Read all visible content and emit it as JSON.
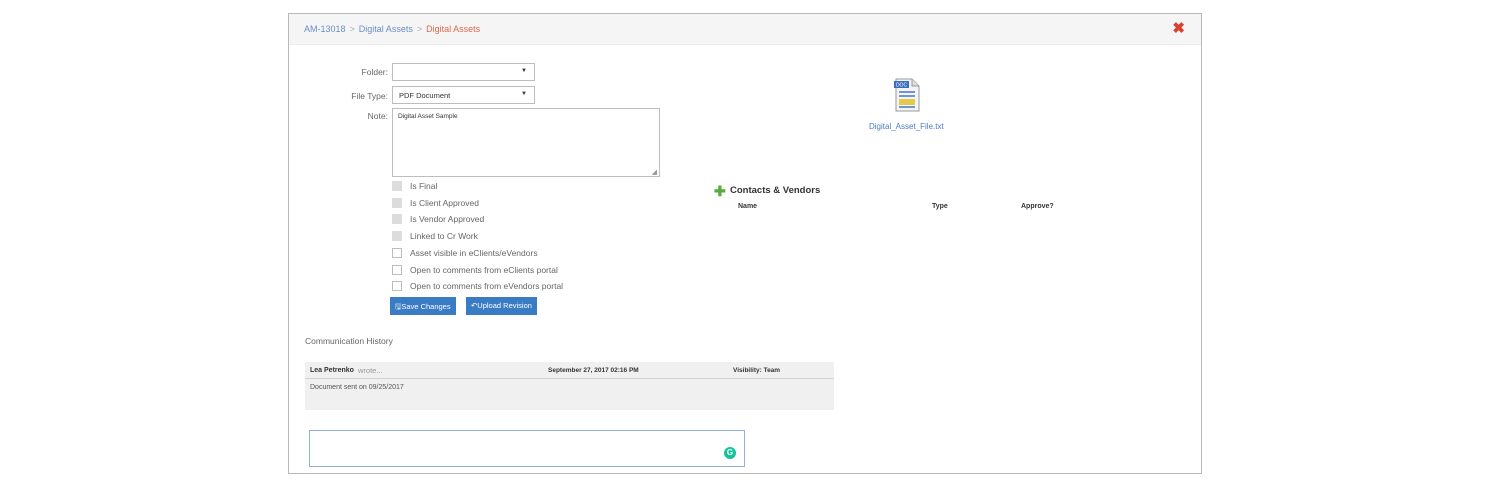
{
  "breadcrumb": {
    "id": "AM-13018",
    "parent": "Digital Assets",
    "current": "Digital Assets",
    "separator": ">"
  },
  "close_icon": "✖",
  "form": {
    "folder_label": "Folder:",
    "folder_value": "",
    "filetype_label": "File Type:",
    "filetype_value": "PDF Document",
    "note_label": "Note:",
    "note_value": "Digital Asset Sample"
  },
  "checkboxes": [
    {
      "label": "Is Final",
      "disabled": true
    },
    {
      "label": "Is Client Approved",
      "disabled": true
    },
    {
      "label": "Is Vendor Approved",
      "disabled": true
    },
    {
      "label": "Linked to Cr Work",
      "disabled": true
    },
    {
      "label": "Asset visible in eClients/eVendors",
      "disabled": false
    },
    {
      "label": "Open to comments from eClients portal",
      "disabled": false
    },
    {
      "label": "Open to comments from eVendors portal",
      "disabled": false
    }
  ],
  "buttons": {
    "save": "Save Changes",
    "upload": "Upload Revision"
  },
  "contacts": {
    "title": "Contacts & Vendors",
    "col_name": "Name",
    "col_type": "Type",
    "col_approve": "Approve?"
  },
  "file": {
    "name": "Digital_Asset_File.txt",
    "icon_label": "DOC",
    "icon": "doc-file-icon"
  },
  "communication": {
    "title": "Communication History",
    "author": "Lea Petrenko",
    "wrote": "wrote...",
    "date": "September 27, 2017 02:16 PM",
    "visibility": "Visibility: Team",
    "body": "Document sent on 09/25/2017"
  },
  "colors": {
    "link": "#6b8fc4",
    "active": "#e0654f",
    "button": "#3a7cc3",
    "close": "#d9412c",
    "plus": "#5aab3b"
  }
}
